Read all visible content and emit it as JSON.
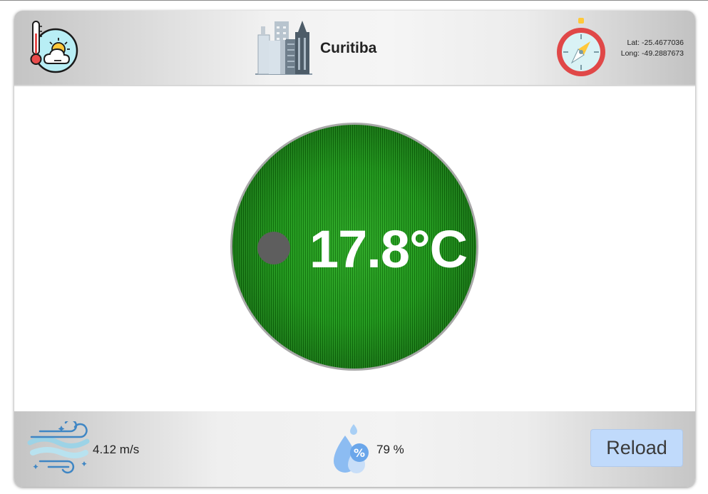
{
  "header": {
    "city": "Curitiba",
    "lat_label": "Lat:",
    "lat_value": "-25.4677036",
    "long_label": "Long:",
    "long_value": "-49.2887673",
    "icons": [
      "thermometer-weather-icon",
      "city-buildings-icon",
      "compass-icon"
    ]
  },
  "main": {
    "temperature": "17.8°C",
    "circle_color": "#169311"
  },
  "footer": {
    "wind": "4.12 m/s",
    "humidity": "79 %",
    "humidity_symbol": "%",
    "reload_label": "Reload",
    "reload_color": "#c0dafb",
    "icons": [
      "wind-icon",
      "humidity-drop-icon"
    ]
  }
}
